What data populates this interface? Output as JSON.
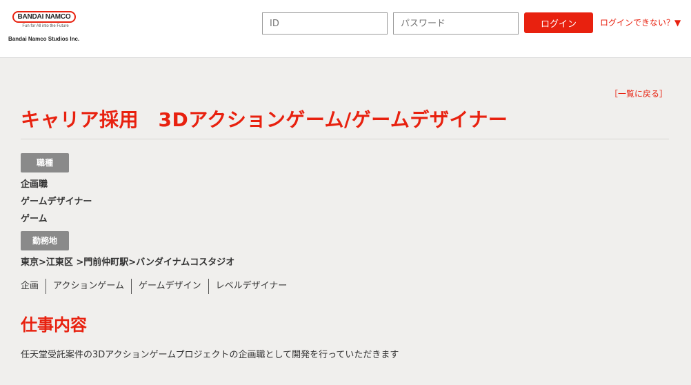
{
  "header": {
    "logo_text": "BANDAI NAMCO",
    "logo_tagline": "Fun for All into the Future",
    "company_name": "Bandai Namco Studios Inc.",
    "id_placeholder": "ID",
    "password_placeholder": "パスワード",
    "login_label": "ログイン",
    "forgot_label": "ログインできない？▼"
  },
  "page": {
    "back_label": "［一覧に戻る］",
    "title": "キャリア採用　3Dアクションゲーム/ゲームデザイナー"
  },
  "job_type": {
    "label": "職種",
    "values": [
      "企画職",
      "ゲームデザイナー",
      "ゲーム"
    ]
  },
  "location": {
    "label": "勤務地",
    "value": "東京>江東区 >門前仲町駅>バンダイナムコスタジオ"
  },
  "tags": [
    "企画",
    "アクションゲーム",
    "ゲームデザイン",
    "レベルデザイナー"
  ],
  "job_description": {
    "heading": "仕事内容",
    "text": "任天堂受託案件の3Dアクションゲームプロジェクトの企画職として開発を行っていただきます"
  },
  "colors": {
    "accent": "#e8210f",
    "badge": "#8a8a8a",
    "background": "#f0efed"
  }
}
